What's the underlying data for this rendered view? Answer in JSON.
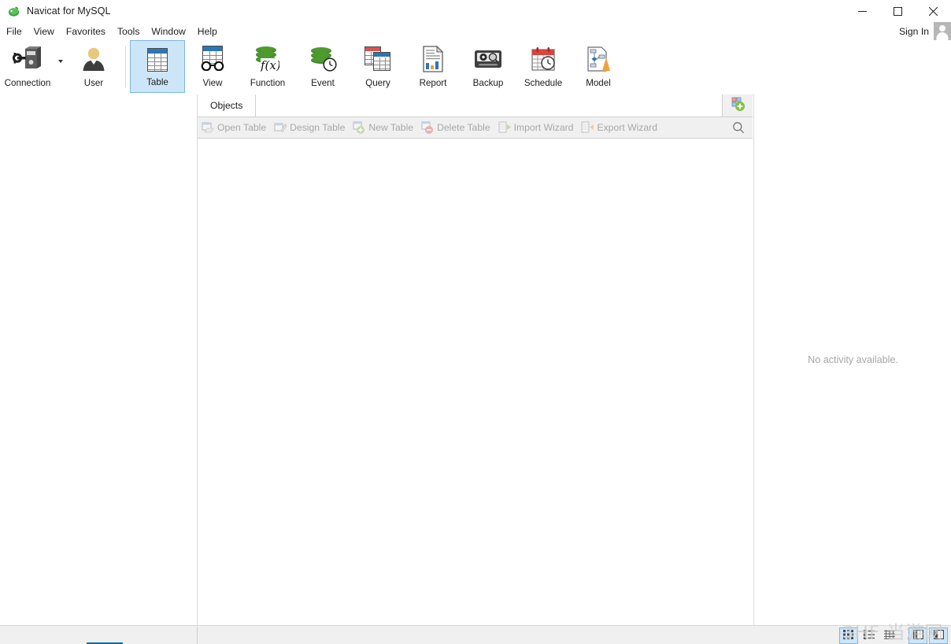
{
  "window": {
    "title": "Navicat for MySQL",
    "app_icon": "navicat-logo-icon",
    "controls": {
      "minimize": "—",
      "maximize": "□",
      "close": "✕"
    }
  },
  "menubar": {
    "items": [
      {
        "label": "File"
      },
      {
        "label": "View"
      },
      {
        "label": "Favorites"
      },
      {
        "label": "Tools"
      },
      {
        "label": "Window"
      },
      {
        "label": "Help"
      }
    ],
    "sign_in_label": "Sign In"
  },
  "toolbar": {
    "buttons": [
      {
        "label": "Connection",
        "icon": "connection-plug-icon",
        "selected": false,
        "has_dropdown": true
      },
      {
        "label": "User",
        "icon": "user-person-icon",
        "selected": false
      },
      {
        "label": "Table",
        "icon": "table-grid-icon",
        "selected": true
      },
      {
        "label": "View",
        "icon": "view-glasses-icon",
        "selected": false
      },
      {
        "label": "Function",
        "icon": "function-fx-icon",
        "selected": false
      },
      {
        "label": "Event",
        "icon": "event-clock-icon",
        "selected": false
      },
      {
        "label": "Query",
        "icon": "query-tables-icon",
        "selected": false
      },
      {
        "label": "Report",
        "icon": "report-document-icon",
        "selected": false
      },
      {
        "label": "Backup",
        "icon": "backup-tape-icon",
        "selected": false
      },
      {
        "label": "Schedule",
        "icon": "schedule-calendar-icon",
        "selected": false
      },
      {
        "label": "Model",
        "icon": "model-diagram-icon",
        "selected": false
      }
    ]
  },
  "center_panel": {
    "tab": {
      "label": "Objects",
      "active": true
    },
    "new_object_icon": "new-object-icon",
    "search_icon": "search-icon",
    "object_actions": [
      {
        "label": "Open Table",
        "icon": "open-table-icon",
        "disabled": true
      },
      {
        "label": "Design Table",
        "icon": "design-table-icon",
        "disabled": true
      },
      {
        "label": "New Table",
        "icon": "new-table-icon",
        "disabled": true
      },
      {
        "label": "Delete Table",
        "icon": "delete-table-icon",
        "disabled": true
      },
      {
        "label": "Import Wizard",
        "icon": "import-wizard-icon",
        "disabled": true
      },
      {
        "label": "Export Wizard",
        "icon": "export-wizard-icon",
        "disabled": true
      }
    ]
  },
  "right_panel": {
    "empty_message": "No activity available."
  },
  "statusbar": {
    "view_buttons": [
      {
        "name": "grid-view",
        "icon": "grid-view-icon",
        "active": true
      },
      {
        "name": "list-view",
        "icon": "list-view-icon",
        "active": false
      },
      {
        "name": "detail-view",
        "icon": "detail-view-icon",
        "active": false
      }
    ],
    "panel_toggles": [
      {
        "name": "left-panel-toggle",
        "icon": "left-panel-icon",
        "active": true
      },
      {
        "name": "right-panel-toggle",
        "icon": "right-panel-icon",
        "active": true
      }
    ]
  },
  "watermark": {
    "text": "3HF 当游网"
  },
  "colors": {
    "accent": "#2e75b6",
    "selected_bg": "#cde6f7",
    "selected_border": "#7eb4ea",
    "panel_bg": "#f0f0f0",
    "disabled_text": "#a8a8a8",
    "muted_text": "#a6a6a6"
  }
}
